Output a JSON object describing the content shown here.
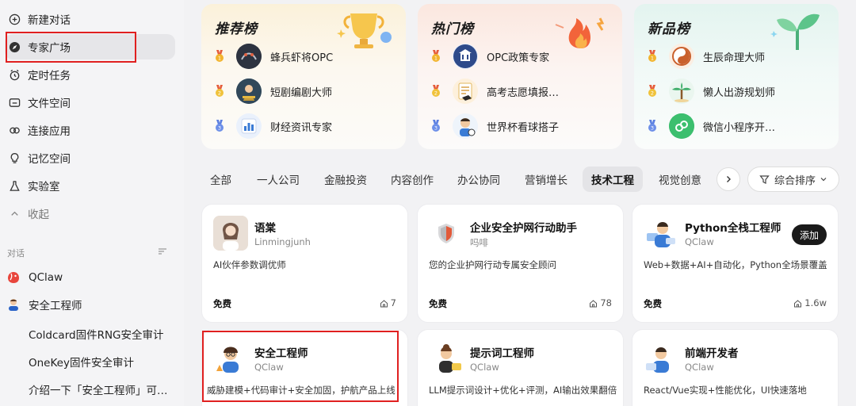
{
  "sidebar": {
    "nav": [
      {
        "label": "新建对话",
        "icon": "plus-circle-icon"
      },
      {
        "label": "专家广场",
        "icon": "compass-icon"
      },
      {
        "label": "定时任务",
        "icon": "alarm-clock-icon"
      },
      {
        "label": "文件空间",
        "icon": "folder-icon"
      },
      {
        "label": "连接应用",
        "icon": "link-icon"
      },
      {
        "label": "记忆空间",
        "icon": "bulb-icon"
      },
      {
        "label": "实验室",
        "icon": "flask-icon"
      },
      {
        "label": "收起",
        "icon": "chevron-up-icon"
      }
    ],
    "section_label": "对话",
    "conversations": [
      {
        "label": "QClaw",
        "icon": "qclaw-logo"
      },
      {
        "label": "安全工程师",
        "icon": "engineer-avatar"
      },
      {
        "label": "Coldcard固件RNG安全审计"
      },
      {
        "label": "OneKey固件安全审计"
      },
      {
        "label": "介绍一下「安全工程师」可…"
      }
    ]
  },
  "boards": [
    {
      "title": "推荐榜",
      "items": [
        {
          "rank": "1",
          "name": "蜂兵虾将OPC"
        },
        {
          "rank": "2",
          "name": "短剧编剧大师"
        },
        {
          "rank": "3",
          "name": "财经资讯专家"
        }
      ]
    },
    {
      "title": "热门榜",
      "items": [
        {
          "rank": "1",
          "name": "OPC政策专家"
        },
        {
          "rank": "2",
          "name": "高考志愿填报…"
        },
        {
          "rank": "3",
          "name": "世界杯看球搭子"
        }
      ]
    },
    {
      "title": "新品榜",
      "items": [
        {
          "rank": "1",
          "name": "生辰命理大师"
        },
        {
          "rank": "2",
          "name": "懒人出游规划师"
        },
        {
          "rank": "3",
          "name": "微信小程序开…"
        }
      ]
    }
  ],
  "tabs": [
    "全部",
    "一人公司",
    "金融投资",
    "内容创作",
    "办公协同",
    "营销增长",
    "技术工程",
    "视觉创意"
  ],
  "active_tab": "技术工程",
  "sort_label": "综合排序",
  "cards": [
    {
      "title": "语棠",
      "author": "Linmingjunh",
      "desc": "AI伙伴参数调优师",
      "price": "免费",
      "count": "7"
    },
    {
      "title": "企业安全护网行动助手",
      "author": "吗啡",
      "desc": "您的企业护网行动专属安全顾问",
      "price": "免费",
      "count": "78"
    },
    {
      "title": "Python全栈工程师",
      "author": "QClaw",
      "desc": "Web+数据+AI+自动化，Python全场景覆盖",
      "price": "免费",
      "count": "1.6w",
      "button": "添加"
    },
    {
      "title": "安全工程师",
      "author": "QClaw",
      "desc": "威胁建模+代码审计+安全加固，护航产品上线"
    },
    {
      "title": "提示词工程师",
      "author": "QClaw",
      "desc": "LLM提示词设计+优化+评测，AI输出效果翻倍"
    },
    {
      "title": "前端开发者",
      "author": "QClaw",
      "desc": "React/Vue实现+性能优化，UI快速落地"
    }
  ],
  "colors": {
    "highlight": "#e02020",
    "active_bg": "#e6e6e9",
    "button_dark": "#1a1a1a"
  }
}
